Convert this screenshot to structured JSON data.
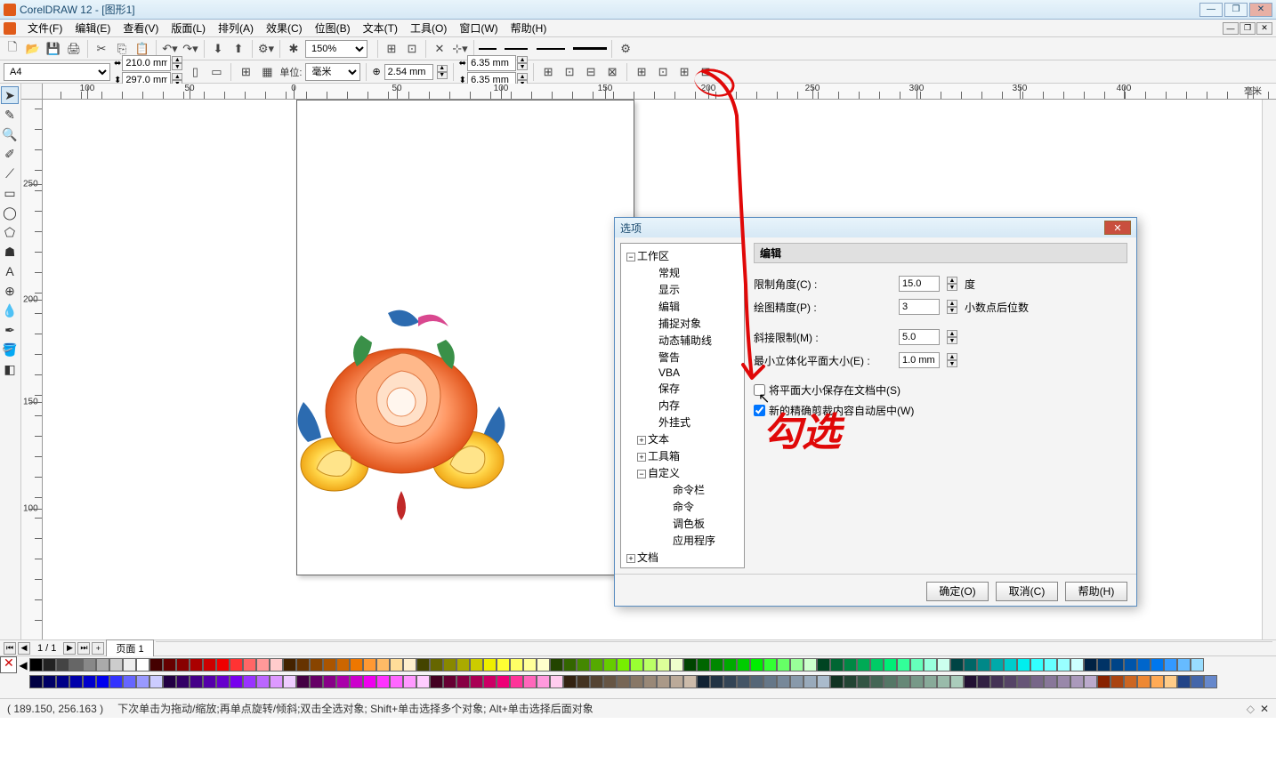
{
  "app_title": "CorelDRAW 12 - [图形1]",
  "menu": [
    "文件(F)",
    "编辑(E)",
    "查看(V)",
    "版面(L)",
    "排列(A)",
    "效果(C)",
    "位图(B)",
    "文本(T)",
    "工具(O)",
    "窗口(W)",
    "帮助(H)"
  ],
  "toolbar1": {
    "zoom": "150%"
  },
  "propbar": {
    "paper": "A4",
    "width": "210.0 mm",
    "height": "297.0 mm",
    "units_label": "单位:",
    "units": "毫米",
    "nudge": "2.54 mm",
    "dup_x": "6.35 mm",
    "dup_y": "6.35 mm"
  },
  "ruler_h": [
    "100",
    "50",
    "0",
    "50",
    "100",
    "150",
    "200",
    "250",
    "300",
    "350",
    "400",
    "毫米"
  ],
  "ruler_v": [
    "250",
    "200",
    "150",
    "100"
  ],
  "page_tabs": {
    "counter": "1 / 1",
    "tab1": "页面 1"
  },
  "statusbar": {
    "coords": "( 189.150, 256.163 )",
    "hint": "下次单击为拖动/缩放;再单点旋转/倾斜;双击全选对象; Shift+单击选择多个对象; Alt+单击选择后面对象"
  },
  "dialog": {
    "title": "选项",
    "tree": {
      "root1": "工作区",
      "items1": [
        "常规",
        "显示",
        "编辑",
        "捕捉对象",
        "动态辅助线",
        "警告",
        "VBA",
        "保存",
        "内存",
        "外挂式"
      ],
      "sub_text": "文本",
      "sub_toolbox": "工具箱",
      "sub_custom": "自定义",
      "custom_items": [
        "命令栏",
        "命令",
        "调色板",
        "应用程序"
      ],
      "root2": "文档"
    },
    "panel": {
      "header": "编辑",
      "angle_label": "限制角度(C) :",
      "angle_val": "15.0",
      "angle_unit": "度",
      "precision_label": "绘图精度(P) :",
      "precision_val": "3",
      "precision_unit": "小数点后位数",
      "miter_label": "斜接限制(M) :",
      "miter_val": "5.0",
      "extrude_label": "最小立体化平面大小(E) :",
      "extrude_val": "1.0 mm",
      "check1": "将平面大小保存在文档中(S)",
      "check2": "新的精确剪裁内容自动居中(W)"
    },
    "buttons": {
      "ok": "确定(O)",
      "cancel": "取消(C)",
      "help": "帮助(H)"
    }
  },
  "annotation": "勾选"
}
